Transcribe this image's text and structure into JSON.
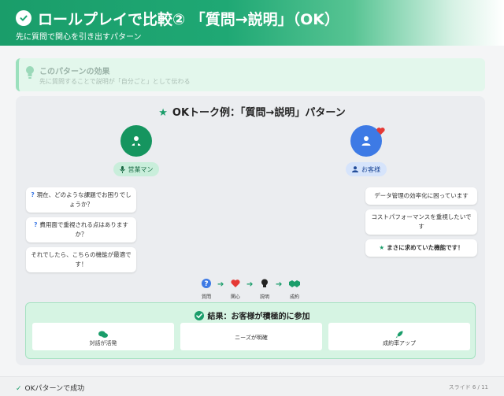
{
  "header": {
    "title": "ロールプレイで比較② 「質問→説明」（OK）",
    "subtitle": "先に質問で関心を引き出すパターン"
  },
  "effect": {
    "title": "このパターンの効果",
    "description": "先に質問することで説明が「自分ごと」として伝わる"
  },
  "panel": {
    "title": "OKトーク例：「質問→説明」パターン",
    "sales_label": "営業マン",
    "customer_label": "お客様",
    "sales_bubbles": [
      "現在、どのような課題でお困りでしょうか？",
      "費用面で重視される点はありますか？",
      "それでしたら、こちらの機能が最適です！"
    ],
    "customer_bubbles": [
      "データ管理の効率化に困っています",
      "コストパフォーマンスを重視したいです",
      "まさに求めていた機能です！"
    ],
    "flow": [
      "質問",
      "関心",
      "説明",
      "成約"
    ]
  },
  "result": {
    "title": "結果：お客様が積極的に参加",
    "cards": [
      "対話が活発",
      "ニーズが明確",
      "成約率アップ"
    ]
  },
  "footer": {
    "status": "OKパターンで成功",
    "slide": "スライド 6 / 11"
  },
  "colors": {
    "brand_green": "#1a9d6a",
    "customer_blue": "#3d7ae5",
    "heart_red": "#e53935"
  }
}
